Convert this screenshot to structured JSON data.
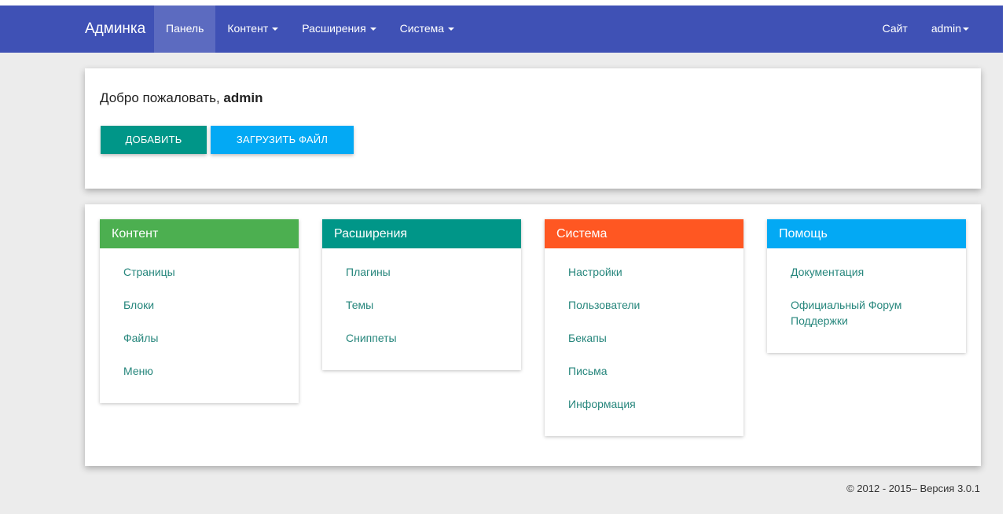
{
  "navbar": {
    "brand": "Админка",
    "bg_color": "#3f51b5",
    "items": [
      {
        "label": "Панель",
        "dropdown": false,
        "active": true
      },
      {
        "label": "Контент",
        "dropdown": true
      },
      {
        "label": "Расширения",
        "dropdown": true
      },
      {
        "label": "Система",
        "dropdown": true
      }
    ],
    "right": {
      "site": "Сайт",
      "user": "admin"
    }
  },
  "welcome": {
    "prefix": "Добро пожаловать, ",
    "username": "admin",
    "add_button": "ДОБАВИТЬ",
    "upload_button": "ЗАГРУЗИТЬ ФАЙЛ"
  },
  "panels": [
    {
      "title": "Контент",
      "color": "#4caf50",
      "links": [
        "Страницы",
        "Блоки",
        "Файлы",
        "Меню"
      ]
    },
    {
      "title": "Расширения",
      "color": "#009688",
      "links": [
        "Плагины",
        "Темы",
        "Сниппеты"
      ]
    },
    {
      "title": "Система",
      "color": "#ff5722",
      "links": [
        "Настройки",
        "Пользователи",
        "Бекапы",
        "Письма",
        "Информация"
      ]
    },
    {
      "title": "Помощь",
      "color": "#03a9f4",
      "links": [
        "Документация",
        "Официальный Форум Поддержки"
      ]
    }
  ],
  "footer": {
    "text": "© 2012 - 2015– Версия 3.0.1"
  }
}
